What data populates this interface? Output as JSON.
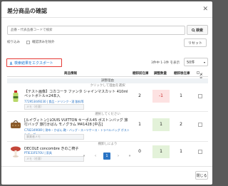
{
  "modal": {
    "title": "差分商品の確認",
    "close_glyph": "✕",
    "close_button": "閉じる"
  },
  "search": {
    "placeholder": "品番・代表品番コードで検索",
    "button_label": "検索"
  },
  "filters": {
    "label": "絞り込み",
    "option": "確認済みを除外"
  },
  "reset_label": "リセット",
  "export_label": "検索結果をエクスポート",
  "count_text": "3件中 1-3件 を表示",
  "per_page": "50件",
  "table": {
    "headers": {
      "product": "商品情報",
      "before": "棚卸前在庫",
      "diff": "調整数量",
      "after": "棚卸後在庫",
      "memo": "メモ"
    },
    "sections": [
      "調整理由",
      "クリックして理由を選択",
      "選択してください",
      "棚卸しにより"
    ],
    "rows": [
      {
        "name": "【テスト画像】コカコーラ ファンタ シャインマスカット 410ml ペットボトル×24本入",
        "sku": "772953449230 | 食品・ドリンク・酒 飲料等",
        "before": "2",
        "diff": "-1",
        "after": "1",
        "memo": "メモ（任意）"
      },
      {
        "name": "[ルイヴィトン] LOUIS VUITTON キーポル45 ボストンバッグ 旅行バッグ 旅行かばん モノグラム M41428 [中古]",
        "sku": "C782349669 | 財布・かばん 鞄・バッグ・スーツケース・トラベルバッグ ボストンバッグ",
        "before": "1",
        "diff": "1",
        "after": "2",
        "memo": "事業者メモ"
      },
      {
        "name": "DECOLE concombre きのこ椅子",
        "sku": "PTIE33FS7OU | 家具",
        "before": "0",
        "diff": "1",
        "after": "1",
        "memo": "メモ（任意）"
      }
    ]
  },
  "pagination": {
    "prev_all": "«",
    "prev": "‹",
    "current": "1",
    "next": "›",
    "next_all": "»"
  },
  "colors": {
    "accent": "#2a74c5",
    "export_border": "#e53935",
    "positive_bg": "#e3f2d9",
    "negative_bg": "#fde2e2"
  }
}
